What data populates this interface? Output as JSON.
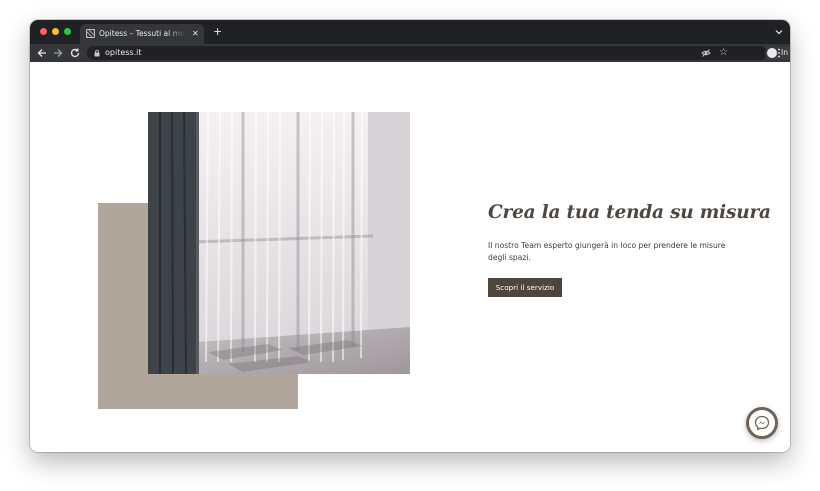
{
  "browser": {
    "tab_title": "Opitess – Tessuti al metro e biancheria",
    "url": "opitess.it",
    "incognito_label": "In incognito",
    "new_tab_glyph": "+",
    "close_glyph": "✕",
    "star_glyph": "☆"
  },
  "hero": {
    "headline": "Crea la tua tenda su misura",
    "description": "Il nostro Team esperto giungerà in loco per prendere le misure degli spazi.",
    "cta_label": "Scopri il servizio"
  },
  "icons": {
    "favicon": "site-favicon-icon",
    "chat": "messenger-icon"
  },
  "colors": {
    "chrome_dark": "#202124",
    "toolbar": "#35363a",
    "accent_block": "#b1a69c",
    "button": "#4e453c",
    "headline_text": "#4e4640"
  }
}
